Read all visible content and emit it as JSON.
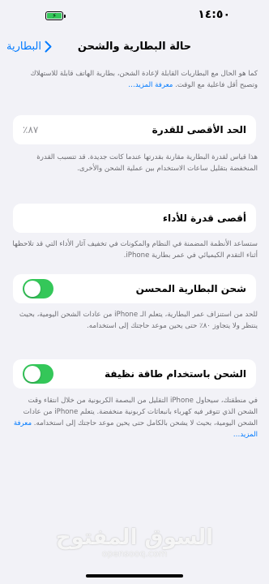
{
  "status_bar": {
    "time": "١٤:٥٠",
    "battery_icon": "battery-charging-icon"
  },
  "nav": {
    "back_label": "البطارية",
    "title": "حالة البطارية والشحن"
  },
  "intro": {
    "text": "كما هو الحال مع البطاريات القابلة لإعادة الشحن، بطارية الهاتف قابلة للاستهلاك وتصبح أقل فاعلية مع الوقت.",
    "link": "معرفة المزيد…"
  },
  "max_capacity": {
    "label": "الحد الأقصى للقدرة",
    "value": "٨٧٪",
    "description": "هذا قياس لقدرة البطارية مقارنة بقدرتها عندما كانت جديدة. قد تتسبب القدرة المنخفضة بتقليل ساعات الاستخدام بين عملية الشحن والأخرى."
  },
  "peak_performance": {
    "label": "أقصى قدرة للأداء",
    "description": "ستساعد الأنظمة المضمنة في النظام والمكونات في تخفيف آثار الأداء التي قد تلاحظها أثناء التقدم الكيميائي في عمر بطارية iPhone."
  },
  "optimized_charging": {
    "label": "شحن البطارية المحسن",
    "enabled": true,
    "description": "للحد من استنزاف عمر البطارية، يتعلم الـ iPhone من عادات الشحن اليومية، بحيث ينتظر ولا يتجاوز ٨٠٪ حتى يحين موعد حاجتك إلى استخدامه."
  },
  "clean_energy": {
    "label": "الشحن باستخدام طاقة نظيفة",
    "enabled": true,
    "description": "في منطقتك، سيحاول iPhone التقليل من البصمة الكربونية من خلال انتقاء وقت الشحن الذي تتوفر فيه كهرباء بانبعاثات كربونية منخفضة. يتعلم iPhone من عادات الشحن اليومية، بحيث لا يشحن بالكامل حتى يحين موعد حاجتك إلى استخدامه.",
    "link": "معرفة المزيد…"
  },
  "watermark": {
    "arabic": "السوق المفتوح",
    "latin": "opensooq.com"
  },
  "colors": {
    "accent": "#007aff",
    "toggle_on": "#34c759",
    "background": "#f2f2f7"
  }
}
